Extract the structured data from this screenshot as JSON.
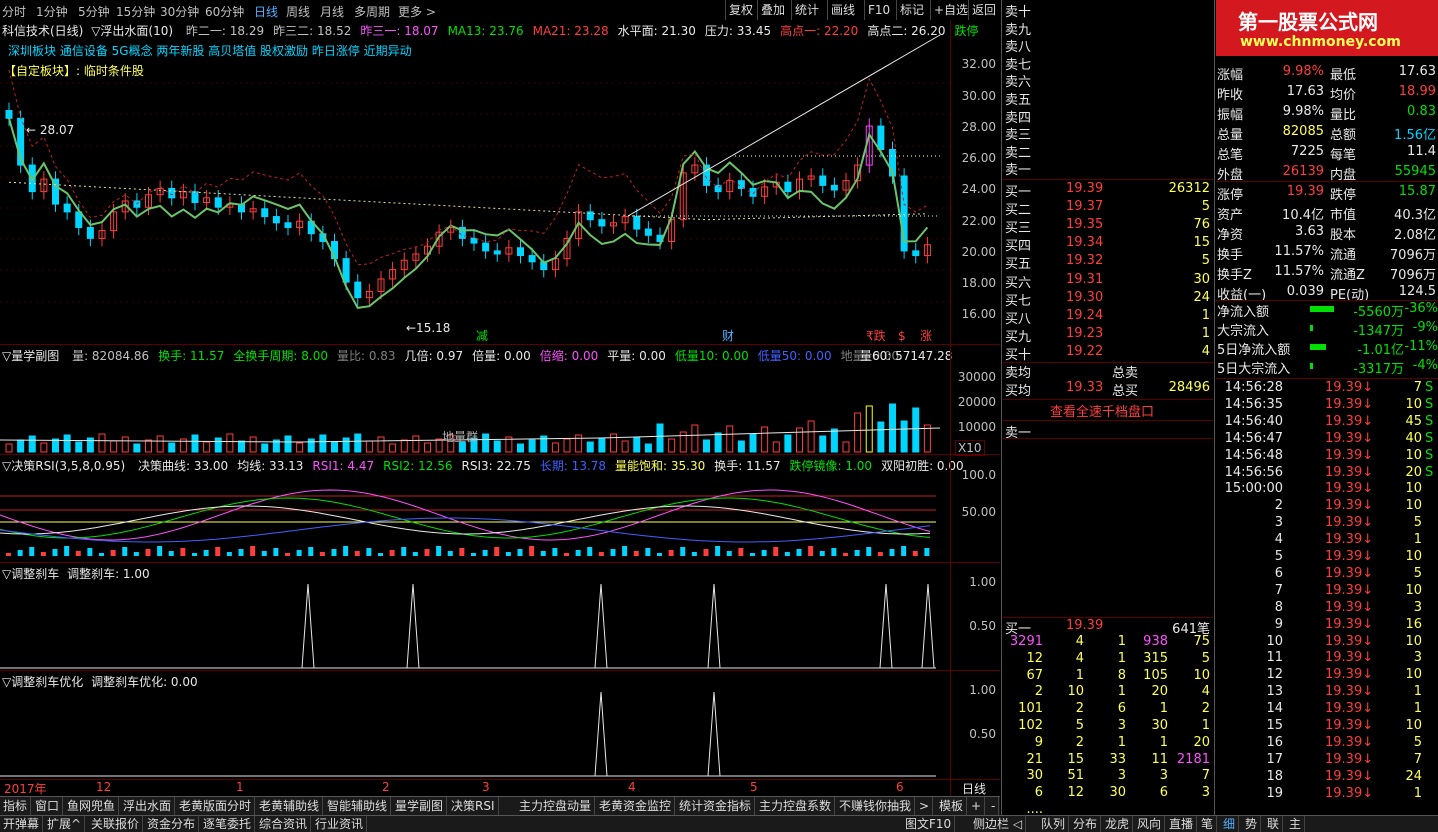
{
  "top_tabs": [
    "分时",
    "1分钟",
    "5分钟",
    "15分钟",
    "30分钟",
    "60分钟",
    "日线",
    "周线",
    "月线",
    "多周期",
    "更多 >"
  ],
  "active_tab": "日线",
  "toolbar_buttons": [
    "复权",
    "叠加",
    "统计",
    "画线",
    "F10",
    "标记",
    "+自选",
    "返回"
  ],
  "chart_title": {
    "name": "科信技术(日线)",
    "indicator": "▽浮出水面(10)",
    "values": [
      {
        "label": "昨二一: 18.29",
        "color": "#c0c0c0"
      },
      {
        "label": "昨三二: 18.52",
        "color": "#c0c0c0"
      },
      {
        "label": "昨三一: 18.07",
        "color": "#ff50ff"
      },
      {
        "label": "MA13: 23.76",
        "color": "#00e000"
      },
      {
        "label": "MA21: 23.28",
        "color": "#ff3d3d"
      },
      {
        "label": "水平面: 21.30",
        "color": "#e8e8e8"
      },
      {
        "label": "压力: 33.45",
        "color": "#e8e8e8"
      },
      {
        "label": "高点一: 22.20",
        "color": "#ff3d3d"
      },
      {
        "label": "高点二: 26.20",
        "color": "#e8e8e8"
      },
      {
        "label": "跌停",
        "color": "#00e000"
      }
    ]
  },
  "concept_line": "深圳板块 通信设备 5G概念 两年新股 高贝塔值 股权激励 昨日涨停 近期异动",
  "custom_block": "【自定板块】: 临时条件股",
  "price_axis": [
    "32.00",
    "30.00",
    "28.00",
    "26.00",
    "24.00",
    "22.00",
    "20.00",
    "18.00",
    "16.00"
  ],
  "price_marks": {
    "high": "28.07",
    "low": "15.18"
  },
  "chart_markers": [
    "减",
    "财",
    "₹跌",
    "$",
    "涨"
  ],
  "volume_panel": {
    "title": "▽量学副图",
    "values": [
      {
        "label": "量: 82084.86",
        "color": "#c0c0c0"
      },
      {
        "label": "换手: 11.57",
        "color": "#00e000"
      },
      {
        "label": "全换手周期: 8.00",
        "color": "#00e000"
      },
      {
        "label": "量比: 0.83",
        "color": "#808080"
      },
      {
        "label": "几倍: 0.97",
        "color": "#e8e8e8"
      },
      {
        "label": "倍量: 0.00",
        "color": "#e8e8e8"
      },
      {
        "label": "倍缩: 0.00",
        "color": "#ff50ff"
      },
      {
        "label": "平量: 0.00",
        "color": "#e8e8e8"
      },
      {
        "label": "低量10: 0.00",
        "color": "#00e000"
      },
      {
        "label": "低量50: 0.00",
        "color": "#4060ff"
      },
      {
        "label": "地量: 0.00",
        "color": "#808080"
      }
    ],
    "right_value": "量60: 57147.28",
    "axis": [
      "30000",
      "20000",
      "10000"
    ],
    "floor_label": "地量群",
    "unit": "X10"
  },
  "rsi_panel": {
    "title": "▽决策RSI(3,5,8,0.95)",
    "values": [
      {
        "label": "决策曲线: 33.00",
        "color": "#e8e8e8"
      },
      {
        "label": "均线: 33.13",
        "color": "#e8e8e8"
      },
      {
        "label": "RSI1: 4.47",
        "color": "#ff50ff"
      },
      {
        "label": "RSI2: 12.56",
        "color": "#00e000"
      },
      {
        "label": "RSI3: 22.75",
        "color": "#e8e8e8"
      },
      {
        "label": "长期: 13.78",
        "color": "#4060ff"
      },
      {
        "label": "量能饱和: 35.30",
        "color": "#ffff55"
      },
      {
        "label": "换手: 11.57",
        "color": "#e8e8e8"
      },
      {
        "label": "跌停镜像: 1.00",
        "color": "#00e000"
      },
      {
        "label": "双阳初胜: 0.00",
        "color": "#e8e8e8"
      }
    ],
    "axis": [
      "100.0",
      "50.00"
    ]
  },
  "brake_panel": {
    "title": "▽调整刹车",
    "value": "调整刹车: 1.00",
    "axis": [
      "1.00",
      "0.50"
    ]
  },
  "brake_opt_panel": {
    "title": "▽调整刹车优化",
    "value": "调整刹车优化: 0.00",
    "axis": [
      "1.00",
      "0.50"
    ]
  },
  "date_axis": [
    "2017年",
    "12",
    "1",
    "2",
    "3",
    "4",
    "5",
    "6"
  ],
  "period_label": "日线",
  "bottom_tabs1": [
    "指标",
    "窗口",
    "鱼网兜鱼",
    "浮出水面",
    "老黄版面分时",
    "老黄辅助线",
    "智能辅助线",
    "量学副图",
    "决策RSI",
    "主力控盘动量",
    "老黄资金监控",
    "统计资金指标",
    "主力控盘系数",
    "不赚钱你抽我",
    ">",
    "模板",
    "+",
    "-"
  ],
  "bottom_tabs2": [
    "开弹幕",
    "扩展^",
    "关联报价",
    "资金分布",
    "逐笔委托",
    "综合资讯",
    "行业资讯"
  ],
  "bottom_right_tabs": [
    "图文F10",
    "侧边栏 ◁",
    "队列",
    "分布",
    "龙虎",
    "风向",
    "直播",
    "笔",
    "细",
    "势",
    "联",
    "主"
  ],
  "watermark": {
    "title": "第一股票公式网",
    "url": "www.chnmoney.com"
  },
  "asks": [
    {
      "label": "卖十",
      "price": "",
      "vol": ""
    },
    {
      "label": "卖九",
      "price": "",
      "vol": ""
    },
    {
      "label": "卖八",
      "price": "",
      "vol": ""
    },
    {
      "label": "卖七",
      "price": "",
      "vol": ""
    },
    {
      "label": "卖六",
      "price": "",
      "vol": ""
    },
    {
      "label": "卖五",
      "price": "",
      "vol": ""
    },
    {
      "label": "卖四",
      "price": "",
      "vol": ""
    },
    {
      "label": "卖三",
      "price": "",
      "vol": ""
    },
    {
      "label": "卖二",
      "price": "",
      "vol": ""
    },
    {
      "label": "卖一",
      "price": "",
      "vol": ""
    }
  ],
  "bids": [
    {
      "label": "买一",
      "price": "19.39",
      "vol": "26312"
    },
    {
      "label": "买二",
      "price": "19.37",
      "vol": "5"
    },
    {
      "label": "买三",
      "price": "19.35",
      "vol": "76"
    },
    {
      "label": "买四",
      "price": "19.34",
      "vol": "15"
    },
    {
      "label": "买五",
      "price": "19.32",
      "vol": "5"
    },
    {
      "label": "买六",
      "price": "19.31",
      "vol": "30"
    },
    {
      "label": "买七",
      "price": "19.30",
      "vol": "24"
    },
    {
      "label": "买八",
      "price": "19.24",
      "vol": "1"
    },
    {
      "label": "买九",
      "price": "19.23",
      "vol": "1"
    },
    {
      "label": "买十",
      "price": "19.22",
      "vol": "4"
    }
  ],
  "avg_rows": [
    {
      "left": "卖均",
      "mid": "总卖",
      "right": ""
    },
    {
      "left": "买均",
      "price": "19.33",
      "mid": "总买",
      "right": "28496"
    }
  ],
  "view_full_depth": "查看全速千档盘口",
  "sell_one_label": "卖一",
  "queue_header": {
    "label": "买一",
    "price": "19.39",
    "count": "641笔"
  },
  "queue_rows": [
    [
      "3291",
      "4",
      "1",
      "938",
      "75"
    ],
    [
      "12",
      "4",
      "1",
      "315",
      "5"
    ],
    [
      "67",
      "1",
      "8",
      "105",
      "10"
    ],
    [
      "2",
      "10",
      "1",
      "20",
      "4"
    ],
    [
      "101",
      "2",
      "6",
      "1",
      "2"
    ],
    [
      "102",
      "5",
      "3",
      "30",
      "1"
    ],
    [
      "9",
      "2",
      "1",
      "1",
      "20"
    ],
    [
      "21",
      "15",
      "33",
      "11",
      "2181"
    ],
    [
      "30",
      "51",
      "3",
      "3",
      "7"
    ],
    [
      "6",
      "12",
      "30",
      "6",
      "3"
    ],
    [
      "....",
      "",
      "",
      "",
      ""
    ]
  ],
  "stats": [
    {
      "l1": "涨幅",
      "v1": "9.98%",
      "c1": "#ff3d3d",
      "l2": "最低",
      "v2": "17.63",
      "c2": "#e8e8e8"
    },
    {
      "l1": "昨收",
      "v1": "17.63",
      "c1": "#e8e8e8",
      "l2": "均价",
      "v2": "18.99",
      "c2": "#ff3d3d"
    },
    {
      "l1": "振幅",
      "v1": "9.98%",
      "c1": "#e8e8e8",
      "l2": "量比",
      "v2": "0.83",
      "c2": "#00e000"
    },
    {
      "l1": "总量",
      "v1": "82085",
      "c1": "#ffff55",
      "l2": "总额",
      "v2": "1.56亿",
      "c2": "#00d5ff"
    },
    {
      "l1": "总笔",
      "v1": "7225",
      "c1": "#e8e8e8",
      "l2": "每笔",
      "v2": "11.4",
      "c2": "#e8e8e8"
    },
    {
      "l1": "外盘",
      "v1": "26139",
      "c1": "#ff3d3d",
      "l2": "内盘",
      "v2": "55945",
      "c2": "#00e000"
    },
    {
      "l1": "涨停",
      "v1": "19.39",
      "c1": "#ff3d3d",
      "l2": "跌停",
      "v2": "15.87",
      "c2": "#00e000"
    },
    {
      "l1": "资产",
      "v1": "10.4亿",
      "c1": "#e8e8e8",
      "l2": "市值",
      "v2": "40.3亿",
      "c2": "#e8e8e8"
    },
    {
      "l1": "净资",
      "v1": "3.63",
      "c1": "#e8e8e8",
      "l2": "股本",
      "v2": "2.08亿",
      "c2": "#e8e8e8"
    },
    {
      "l1": "换手",
      "v1": "11.57%",
      "c1": "#e8e8e8",
      "l2": "流通",
      "v2": "7096万",
      "c2": "#e8e8e8"
    },
    {
      "l1": "换手Z",
      "v1": "11.57%",
      "c1": "#e8e8e8",
      "l2": "流通Z",
      "v2": "7096万",
      "c2": "#e8e8e8"
    },
    {
      "l1": "收益(一)",
      "v1": "0.039",
      "c1": "#e8e8e8",
      "l2": "PE(动)",
      "v2": "124.5",
      "c2": "#e8e8e8"
    }
  ],
  "flows": [
    {
      "label": "净流入额",
      "value": "-5560万",
      "pct": "-36%",
      "bar": 36
    },
    {
      "label": "大宗流入",
      "value": "-1347万",
      "pct": "-9%",
      "bar": 4
    },
    {
      "label": "5日净流入额",
      "value": "-1.01亿",
      "pct": "-11%",
      "bar": 24
    },
    {
      "label": "5日大宗流入",
      "value": "-3317万",
      "pct": "-4%",
      "bar": 4
    }
  ],
  "ticks": [
    {
      "time": "14:56:28",
      "price": "19.39",
      "vol": "7",
      "side": "S"
    },
    {
      "time": "14:56:35",
      "price": "19.39",
      "vol": "10",
      "side": "S"
    },
    {
      "time": "14:56:40",
      "price": "19.39",
      "vol": "45",
      "side": "S"
    },
    {
      "time": "14:56:47",
      "price": "19.39",
      "vol": "40",
      "side": "S"
    },
    {
      "time": "14:56:48",
      "price": "19.39",
      "vol": "10",
      "side": "S"
    },
    {
      "time": "14:56:56",
      "price": "19.39",
      "vol": "20",
      "side": "S"
    },
    {
      "time": "15:00:00",
      "price": "19.39",
      "vol": "10",
      "side": ""
    },
    {
      "time": "2",
      "price": "19.39",
      "vol": "10",
      "side": ""
    },
    {
      "time": "3",
      "price": "19.39",
      "vol": "5",
      "side": ""
    },
    {
      "time": "4",
      "price": "19.39",
      "vol": "1",
      "side": ""
    },
    {
      "time": "5",
      "price": "19.39",
      "vol": "10",
      "side": ""
    },
    {
      "time": "6",
      "price": "19.39",
      "vol": "5",
      "side": ""
    },
    {
      "time": "7",
      "price": "19.39",
      "vol": "10",
      "side": ""
    },
    {
      "time": "8",
      "price": "19.39",
      "vol": "3",
      "side": ""
    },
    {
      "time": "9",
      "price": "19.39",
      "vol": "16",
      "side": ""
    },
    {
      "time": "10",
      "price": "19.39",
      "vol": "10",
      "side": ""
    },
    {
      "time": "11",
      "price": "19.39",
      "vol": "3",
      "side": ""
    },
    {
      "time": "12",
      "price": "19.39",
      "vol": "10",
      "side": ""
    },
    {
      "time": "13",
      "price": "19.39",
      "vol": "1",
      "side": ""
    },
    {
      "time": "14",
      "price": "19.39",
      "vol": "1",
      "side": ""
    },
    {
      "time": "15",
      "price": "19.39",
      "vol": "10",
      "side": ""
    },
    {
      "time": "16",
      "price": "19.39",
      "vol": "5",
      "side": ""
    },
    {
      "time": "17",
      "price": "19.39",
      "vol": "7",
      "side": ""
    },
    {
      "time": "18",
      "price": "19.39",
      "vol": "24",
      "side": ""
    },
    {
      "time": "19",
      "price": "19.39",
      "vol": "1",
      "side": ""
    }
  ],
  "partial_top_rows": [
    {
      "l1": "涨幅",
      "note": "partially hidden"
    }
  ]
}
